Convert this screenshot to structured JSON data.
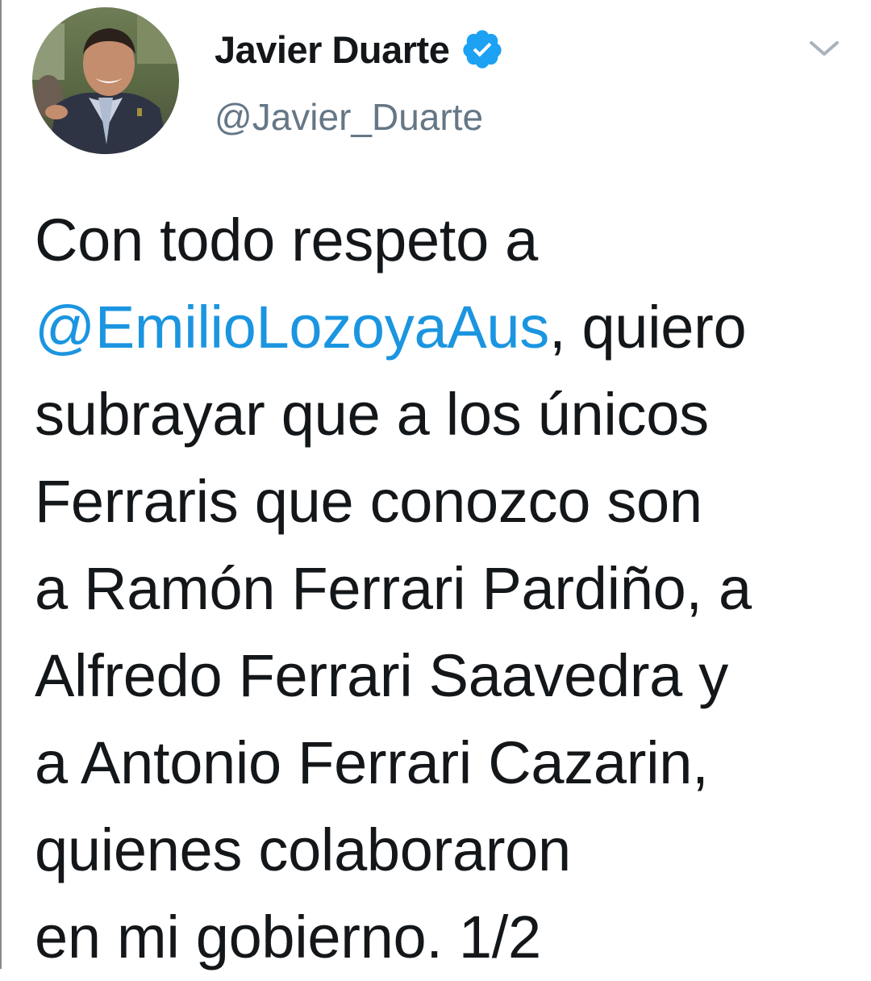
{
  "user": {
    "display_name": "Javier Duarte",
    "handle": "@Javier_Duarte",
    "verified": true,
    "verified_color": "#1da1f2"
  },
  "header": {
    "menu_icon": "chevron-down-icon"
  },
  "tweet": {
    "lines": [
      {
        "text": "Con todo respeto a"
      },
      {
        "mention": "@EmilioLozoyaAus",
        "text": ", quiero"
      },
      {
        "text": "subrayar que a los únicos"
      },
      {
        "text": "Ferraris que conozco son"
      },
      {
        "text": "a Ramón Ferrari Pardiño, a"
      },
      {
        "text": "Alfredo Ferrari Saavedra y"
      },
      {
        "text": "a Antonio Ferrari Cazarin,"
      },
      {
        "text": "quienes colaboraron"
      },
      {
        "text": "en mi gobierno. 1/2"
      }
    ]
  },
  "colors": {
    "text": "#14171a",
    "secondary": "#657786",
    "link": "#1b95e0",
    "background": "#ffffff"
  }
}
